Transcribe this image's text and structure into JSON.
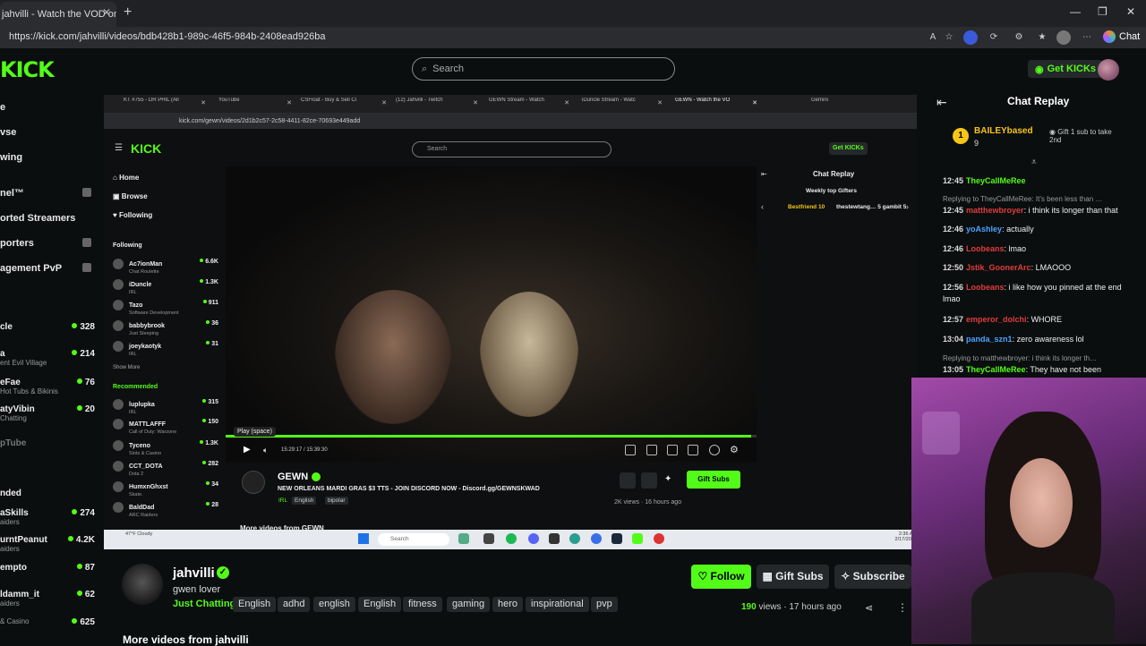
{
  "browser": {
    "tab_title": "jahvilli - Watch the VOD on Ki",
    "url": "https://kick.com/jahvilli/videos/bdb428b1-989c-46f5-984b-2408ead926ba",
    "chat_button": "Chat"
  },
  "header": {
    "logo": "KICK",
    "search_placeholder": "Search",
    "get_kicks": "Get KICKs"
  },
  "left_nav": {
    "items": [
      "e",
      "vse",
      "wing",
      "nel™",
      "orted Streamers",
      "porters",
      "agement PvP"
    ],
    "channels": [
      {
        "name": "cle",
        "sub": "",
        "count": "328"
      },
      {
        "name": "a",
        "sub": "ent Evil Village",
        "count": "214"
      },
      {
        "name": "eFae",
        "sub": "Hot Tubs & Bikinis",
        "count": "76"
      },
      {
        "name": "atyVibin",
        "sub": "Chatting",
        "count": "20"
      },
      {
        "name": "pTube",
        "sub": "",
        "count": ""
      }
    ],
    "ended_label": "nded",
    "ended_channels": [
      {
        "name": "aSkills",
        "sub": "aiders",
        "count": "274"
      },
      {
        "name": "urntPeanut",
        "sub": "aiders",
        "count": "4.2K"
      },
      {
        "name": "empto",
        "sub": "",
        "count": "87"
      },
      {
        "name": "ldamm_it",
        "sub": "aiders",
        "count": "62"
      },
      {
        "name": "",
        "sub": "& Casino",
        "count": "625"
      }
    ]
  },
  "embed": {
    "tabs": [
      "KT #755 - DR PHIL (All",
      "YouTube",
      "CSFloat - Buy & Sell Ci",
      "(12) Jahvilli - Twitch",
      "GEWN Stream - Watch",
      "iDuncle Stream - Watc",
      "GEWN - Watch the VO",
      "Gemini"
    ],
    "url": "kick.com/gewn/videos/2d1b2c57-2c58-4411-82ce-70693e449add",
    "logo": "KICK",
    "search_placeholder": "Search",
    "get_kicks": "Get KICKs",
    "nav": [
      "Home",
      "Browse",
      "Following"
    ],
    "following_label": "Following",
    "following": [
      {
        "name": "Ac7ionMan",
        "sub": "Chat Roulette",
        "count": "6.6K"
      },
      {
        "name": "iDuncle",
        "sub": "IRL",
        "count": "1.3K"
      },
      {
        "name": "Tazo",
        "sub": "Software Development",
        "count": "911"
      },
      {
        "name": "babbybrook",
        "sub": "Just Sleeping",
        "count": "36"
      },
      {
        "name": "joeykaotyk",
        "sub": "IRL",
        "count": "31"
      }
    ],
    "show_more": "Show More",
    "recommended_label": "Recommended",
    "recommended": [
      {
        "name": "luplupka",
        "sub": "IRL",
        "count": "315"
      },
      {
        "name": "MATTLAFFF",
        "sub": "Call of Duty: Warzone",
        "count": "150"
      },
      {
        "name": "Tyceno",
        "sub": "Slots & Casino",
        "count": "1.3K"
      },
      {
        "name": "CCT_DOTA",
        "sub": "Dota 2",
        "count": "282"
      },
      {
        "name": "HumxnGhxst",
        "sub": "Skate.",
        "count": "34"
      },
      {
        "name": "BaldDad",
        "sub": "ARC Raiders",
        "count": "28"
      }
    ],
    "tooltip": "Play (space)",
    "time": "15:29:17 / 15:39:30",
    "progress": 0.99,
    "channel": "GEWN",
    "title": "NEW ORLEANS MARDI GRAS $3 TTS - JOIN DISCORD NOW - Discord.gg/GEWNSKWAD",
    "tags": [
      "IRL",
      "English",
      "bipolar"
    ],
    "gift_subs": "Gift Subs",
    "views": "2K views · 16 hours ago",
    "more_videos": "More videos from GEWN",
    "chat_replay": "Chat Replay",
    "top_gifters": "Weekly top Gifters",
    "gifter1": "Bestfriend 10",
    "gifter2": "thestewtang… 5  gambit 5",
    "taskbar_search": "Search",
    "weather": "47°F Cloudy",
    "clock": "2:36 AM 2/17/2026"
  },
  "channel": {
    "name": "jahvilli",
    "bio": "gwen lover",
    "category": "Just Chatting",
    "tags": [
      "English",
      "adhd",
      "english",
      "English",
      "fitness",
      "gaming",
      "hero",
      "inspirational",
      "pvp"
    ],
    "follow": "Follow",
    "gift_subs": "Gift Subs",
    "subscribe": "Subscribe",
    "views_count": "190",
    "views_suffix": "views",
    "ago": "17 hours ago",
    "more_videos": "More videos from jahvilli"
  },
  "chat": {
    "title": "Chat Replay",
    "top_gifter": {
      "rank": "1",
      "name": "BAILEYbased",
      "count": "9",
      "message": "Gift 1 sub to take 2nd"
    },
    "messages": [
      {
        "time": "12:45",
        "user": "TheyCallMeRee",
        "color": "#53fc18",
        "text": "",
        "reply": ""
      },
      {
        "time": "12:45",
        "user": "matthewbroyer",
        "color": "#e03c3c",
        "text": ": i think its longer than that",
        "reply": "Replying to TheyCallMeRee: It's been less than …"
      },
      {
        "time": "12:46",
        "user": "yoAshley",
        "color": "#4aa3ff",
        "text": ": actually",
        "reply": ""
      },
      {
        "time": "12:46",
        "user": "Loobeans",
        "color": "#e03c3c",
        "text": ": lmao",
        "reply": ""
      },
      {
        "time": "12:50",
        "user": "Jstik_GoonerArc",
        "color": "#e03c3c",
        "text": ": LMAOOO",
        "reply": ""
      },
      {
        "time": "12:56",
        "user": "Loobeans",
        "color": "#e03c3c",
        "text": ": i like how you pinned at the end lmao",
        "reply": ""
      },
      {
        "time": "12:57",
        "user": "emperor_dolchi",
        "color": "#e03c3c",
        "text": ": WHORE",
        "reply": ""
      },
      {
        "time": "13:04",
        "user": "panda_szn1",
        "color": "#4aa3ff",
        "text": ": zero awareness lol",
        "reply": ""
      },
      {
        "time": "13:05",
        "user": "TheyCallMeRee",
        "color": "#53fc18",
        "text": ": They have not been",
        "reply": "Replying to matthewbroyer: i think its longer th…"
      }
    ]
  },
  "colors": {
    "accent": "#53fc18",
    "background": "#0b0e0f",
    "gifter": "#f5c518"
  }
}
